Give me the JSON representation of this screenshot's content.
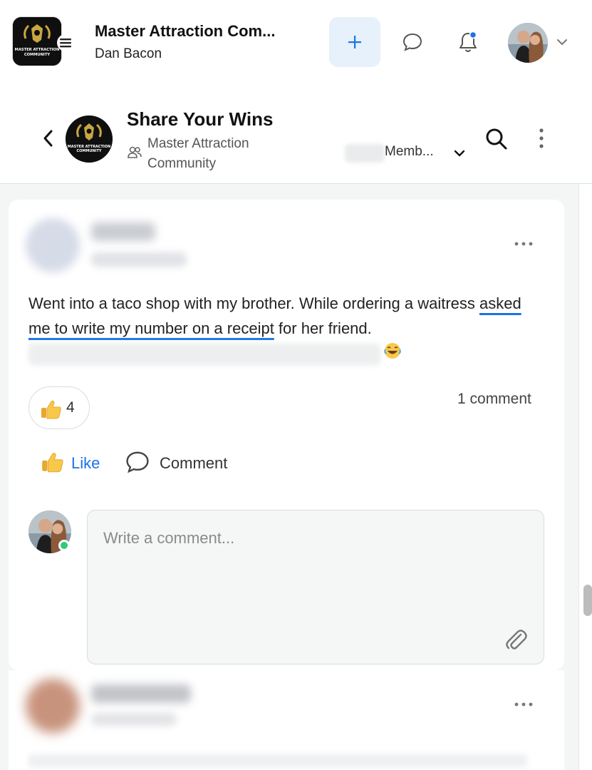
{
  "topbar": {
    "app_title": "Master Attraction Com...",
    "user_name": "Dan Bacon",
    "logo_text": "MASTER ATTRACTION COMMUNITY",
    "icons": [
      "menu-icon",
      "plus-icon",
      "chat-bubble-icon",
      "bell-icon",
      "chevron-down-icon"
    ],
    "bell_badge_color": "#1a73e8",
    "plus_bg_color": "#e6f1fb"
  },
  "group": {
    "title": "Share Your Wins",
    "community_name": "Master Attraction Community",
    "members_label": "Memb..."
  },
  "post": {
    "text_before": "Went into a taco shop with my brother. While ordering a waitress ",
    "text_highlight": "asked me to write my number on a receipt",
    "text_after": " for her friend. ",
    "reaction_count": "4",
    "comment_count": "1 comment",
    "like_label": "Like",
    "comment_label": "Comment",
    "comment_placeholder": "Write a comment..."
  },
  "colors": {
    "accent": "#1a73e8",
    "online": "#2fca7a"
  }
}
